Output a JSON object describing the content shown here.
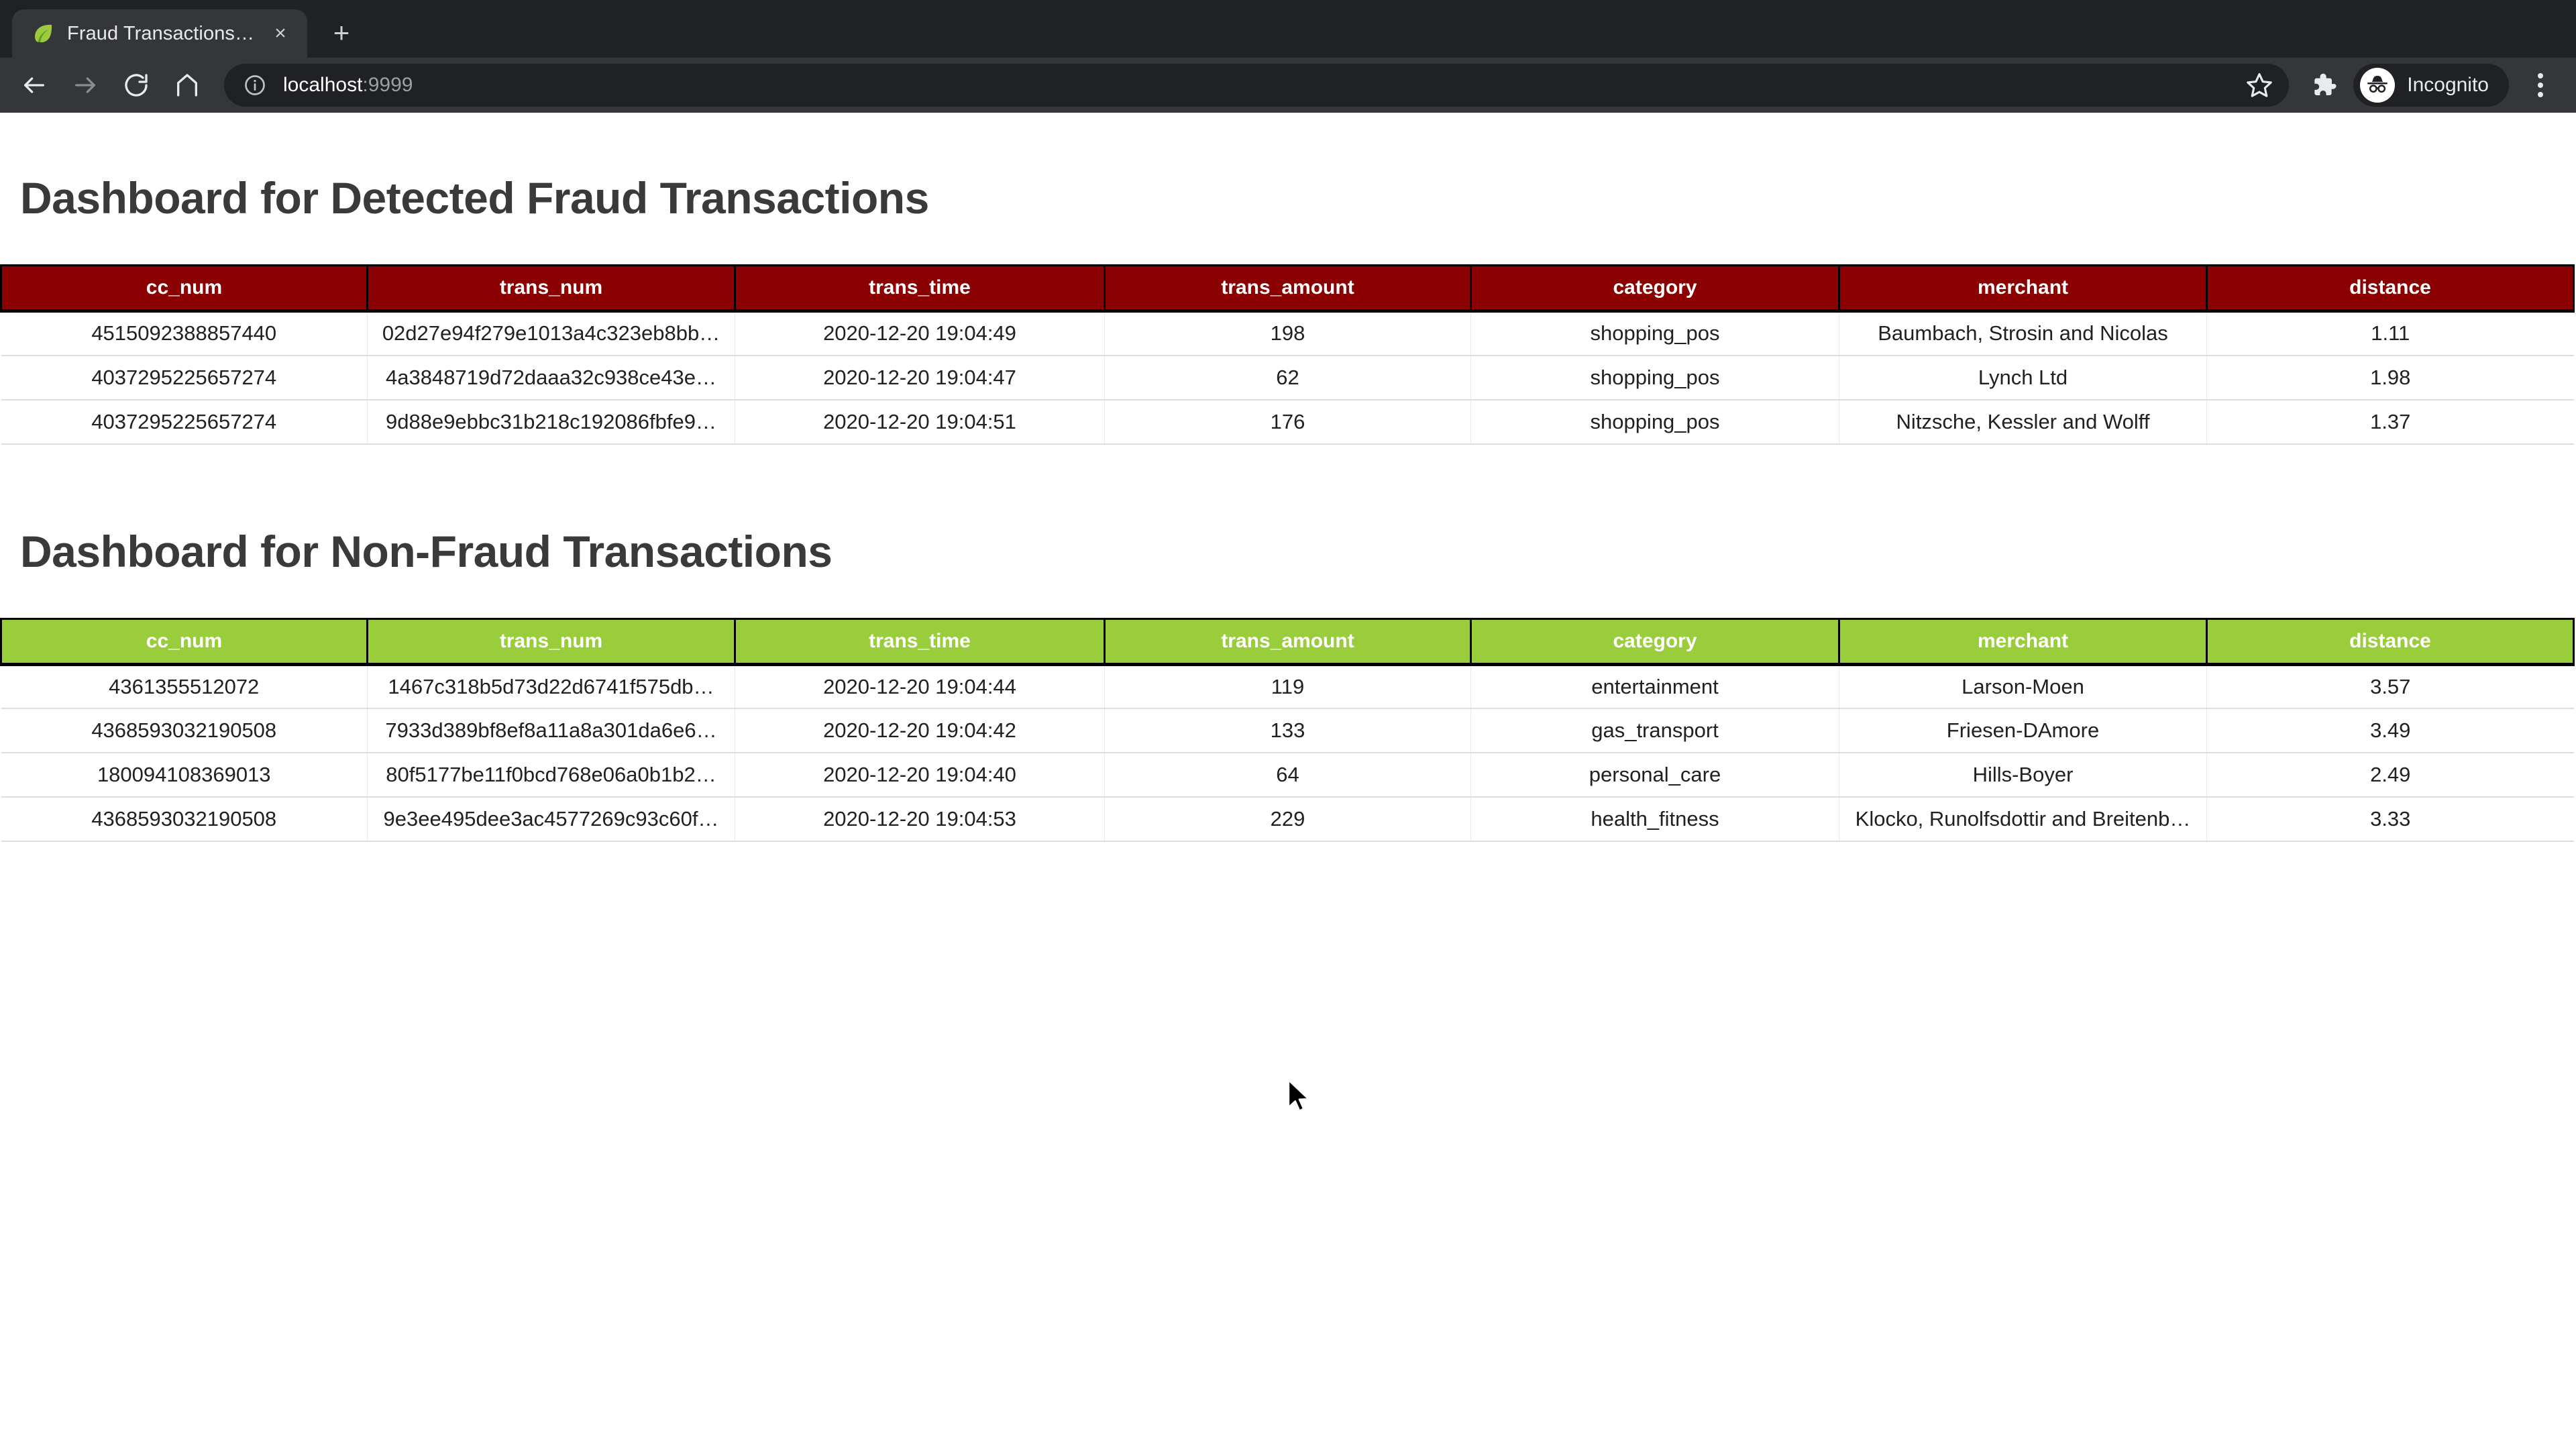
{
  "browser": {
    "tab": {
      "title": "Fraud Transactions Dashboard",
      "favicon_name": "leaf-favicon",
      "close_label": "×"
    },
    "new_tab_label": "+",
    "nav": {
      "back_label": "←",
      "forward_label": "→",
      "reload_label": "↻",
      "home_label": "⌂"
    },
    "omnibox": {
      "host": "localhost",
      "port": ":9999",
      "info_icon": "site-info-icon"
    },
    "profile": {
      "incognito_label": "Incognito"
    }
  },
  "page": {
    "fraud": {
      "heading": "Dashboard for Detected Fraud Transactions",
      "header_color": "#8b0000",
      "columns": [
        "cc_num",
        "trans_num",
        "trans_time",
        "trans_amount",
        "category",
        "merchant",
        "distance"
      ],
      "rows": [
        [
          "4515092388857440",
          "02d27e94f279e1013a4c323eb8bb…",
          "2020-12-20 19:04:49",
          "198",
          "shopping_pos",
          "Baumbach, Strosin and Nicolas",
          "1.11"
        ],
        [
          "4037295225657274",
          "4a3848719d72daaa32c938ce43e…",
          "2020-12-20 19:04:47",
          "62",
          "shopping_pos",
          "Lynch Ltd",
          "1.98"
        ],
        [
          "4037295225657274",
          "9d88e9ebbc31b218c192086fbfe9…",
          "2020-12-20 19:04:51",
          "176",
          "shopping_pos",
          "Nitzsche, Kessler and Wolff",
          "1.37"
        ]
      ]
    },
    "nonfraud": {
      "heading": "Dashboard for Non-Fraud Transactions",
      "header_color": "#9acd3c",
      "columns": [
        "cc_num",
        "trans_num",
        "trans_time",
        "trans_amount",
        "category",
        "merchant",
        "distance"
      ],
      "rows": [
        [
          "4361355512072",
          "1467c318b5d73d22d6741f575db…",
          "2020-12-20 19:04:44",
          "119",
          "entertainment",
          "Larson-Moen",
          "3.57"
        ],
        [
          "4368593032190508",
          "7933d389bf8ef8a11a8a301da6e6…",
          "2020-12-20 19:04:42",
          "133",
          "gas_transport",
          "Friesen-DAmore",
          "3.49"
        ],
        [
          "180094108369013",
          "80f5177be11f0bcd768e06a0b1b2…",
          "2020-12-20 19:04:40",
          "64",
          "personal_care",
          "Hills-Boyer",
          "2.49"
        ],
        [
          "4368593032190508",
          "9e3ee495dee3ac4577269c93c60f…",
          "2020-12-20 19:04:53",
          "229",
          "health_fitness",
          "Klocko, Runolfsdottir and Breitenb…",
          "3.33"
        ]
      ]
    }
  }
}
